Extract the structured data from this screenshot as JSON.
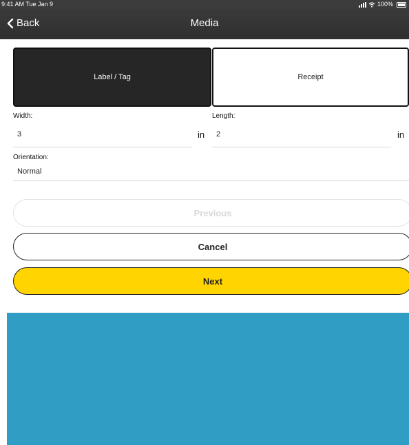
{
  "status_bar": {
    "time_date": "9:41 AM  Tue Jan 9",
    "battery_percent": "100%"
  },
  "nav": {
    "back_label": "Back",
    "title": "Media"
  },
  "media_type": {
    "options": [
      {
        "label": "Label / Tag",
        "selected": true
      },
      {
        "label": "Receipt",
        "selected": false
      }
    ]
  },
  "fields": {
    "width": {
      "label": "Width:",
      "value": "3",
      "unit": "in"
    },
    "length": {
      "label": "Length:",
      "value": "2",
      "unit": "in"
    },
    "orientation": {
      "label": "Orientation:",
      "value": "Normal"
    }
  },
  "buttons": {
    "previous": "Previous",
    "cancel": "Cancel",
    "next": "Next"
  },
  "colors": {
    "nav_bar": "#333333",
    "selected_segment": "#262626",
    "next_button": "#ffd400",
    "bottom_panel": "#2f9dc4",
    "disabled_text": "#d8d8d8"
  },
  "icons": {
    "back": "chevron-left-icon",
    "signal": "cellular-signal-icon",
    "wifi": "wifi-icon",
    "battery": "battery-icon"
  }
}
